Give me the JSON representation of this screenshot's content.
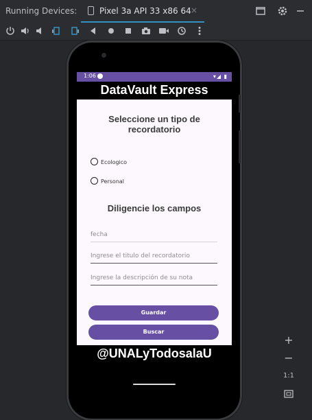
{
  "tool_window": {
    "title": "Running Devices:",
    "tab_label": "Pixel 3a API 33 x86 64",
    "close_glyph": "×"
  },
  "toolbar_icons": [
    "power-icon",
    "volume-up-icon",
    "volume-down-icon",
    "rotate-left-icon",
    "rotate-right-icon",
    "back-icon",
    "home-icon",
    "overview-icon",
    "screenshot-icon",
    "screen-record-icon",
    "snapshot-icon",
    "more-icon"
  ],
  "device": {
    "status_time": "1:06",
    "status_icons": "▾◢ ▮",
    "app_title": "DataVault Express",
    "section1_title_line1": "Seleccione un tipo de",
    "section1_title_line2": "recordatorio",
    "radio_options": [
      "Ecologico",
      "Personal"
    ],
    "section2_title": "Diligencie los campos",
    "fields": [
      {
        "placeholder": "fecha"
      },
      {
        "placeholder": "Ingrese el titulo del recordatorio"
      },
      {
        "placeholder": "Ingrese la descripción de su nota"
      }
    ],
    "save_button": "Guardar",
    "search_button": "Buscar"
  },
  "watermark": "@UNALyTodosalaU",
  "zoom": {
    "plus": "+",
    "minus": "−",
    "one_to_one": "1:1"
  },
  "colors": {
    "accent": "#6750a4",
    "ide_bg": "#2b2d30",
    "tab_underline": "#3592c4"
  }
}
